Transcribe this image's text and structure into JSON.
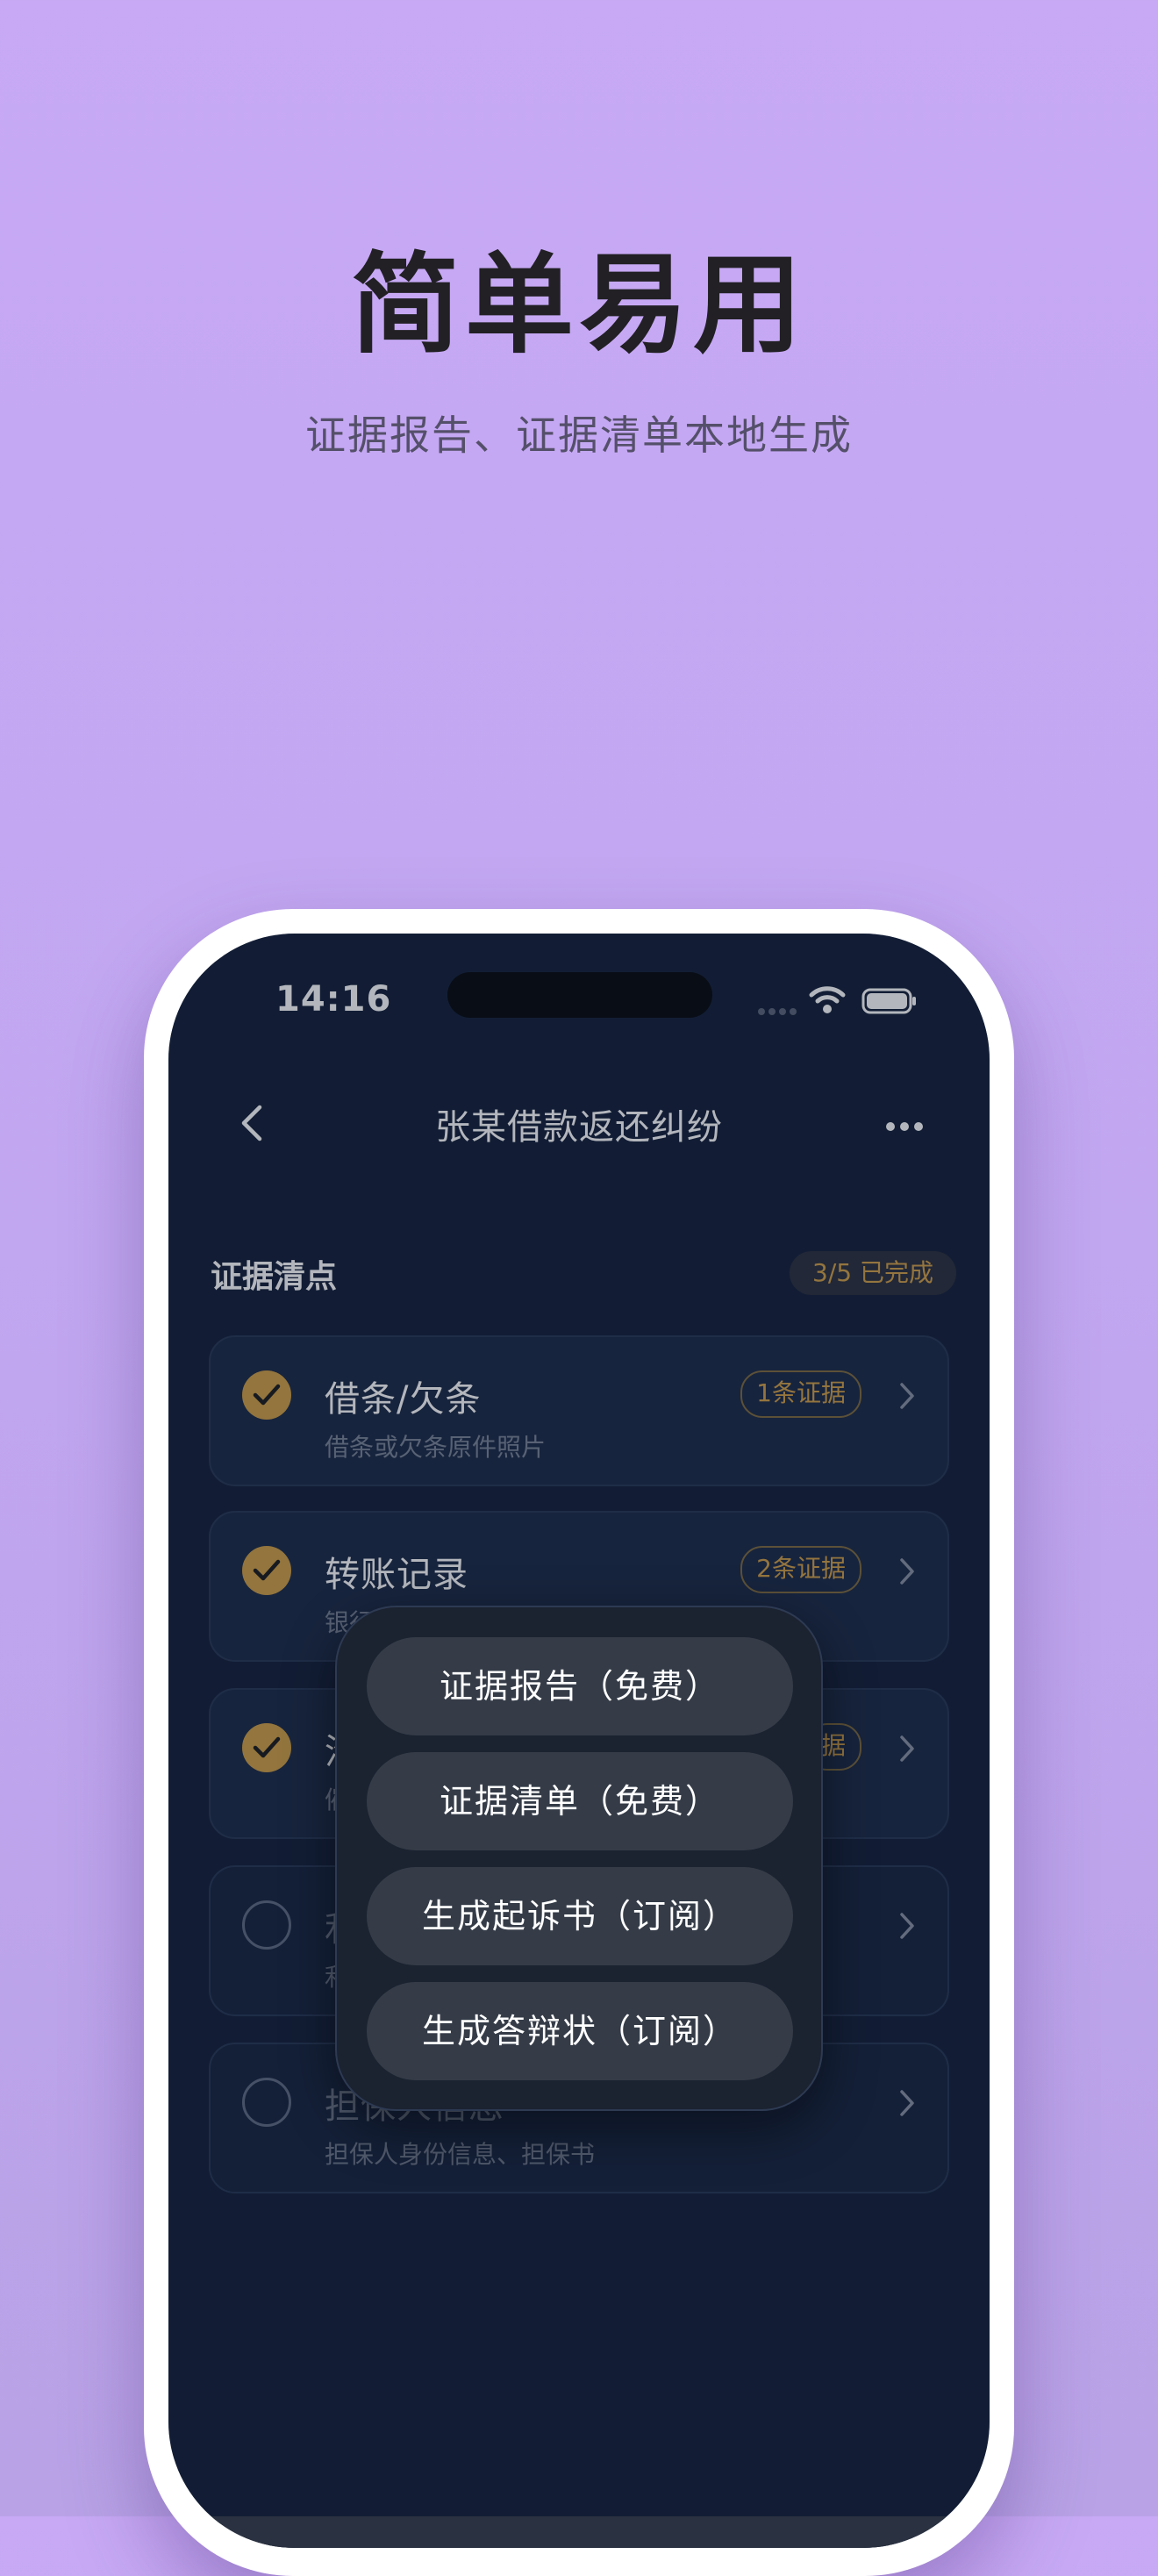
{
  "hero": {
    "title": "简单易用",
    "subtitle": "证据报告、证据清单本地生成"
  },
  "status_bar": {
    "time": "14:16",
    "icons": [
      "signal-icon",
      "wifi-icon",
      "battery-icon"
    ]
  },
  "nav": {
    "back_icon": "chevron-left-icon",
    "title": "张某借款返还纠纷",
    "more_icon": "more-horizontal-icon"
  },
  "section": {
    "title": "证据清点",
    "progress": "3/5 已完成",
    "completed": 3,
    "total": 5
  },
  "items": [
    {
      "title": "借条/欠条",
      "desc": "借条或欠条原件照片",
      "badge": "1条证据",
      "done": true
    },
    {
      "title": "转账记录",
      "desc": "银行",
      "badge": "2条证据",
      "done": true
    },
    {
      "title": "沟",
      "desc": "催",
      "badge": "据",
      "done": true
    },
    {
      "title": "利",
      "desc": "利",
      "badge": "",
      "done": false
    },
    {
      "title": "担保人信息",
      "desc": "担保人身份信息、担保书",
      "badge": "",
      "done": false
    }
  ],
  "popup": {
    "buttons": [
      "证据报告（免费）",
      "证据清单（免费）",
      "生成起诉书（订阅）",
      "生成答辩状（订阅）"
    ]
  },
  "colors": {
    "background": "#c7a9f5",
    "screen": "#121e38",
    "accent_gold": "#d09f45",
    "popup": "#1b2230"
  }
}
